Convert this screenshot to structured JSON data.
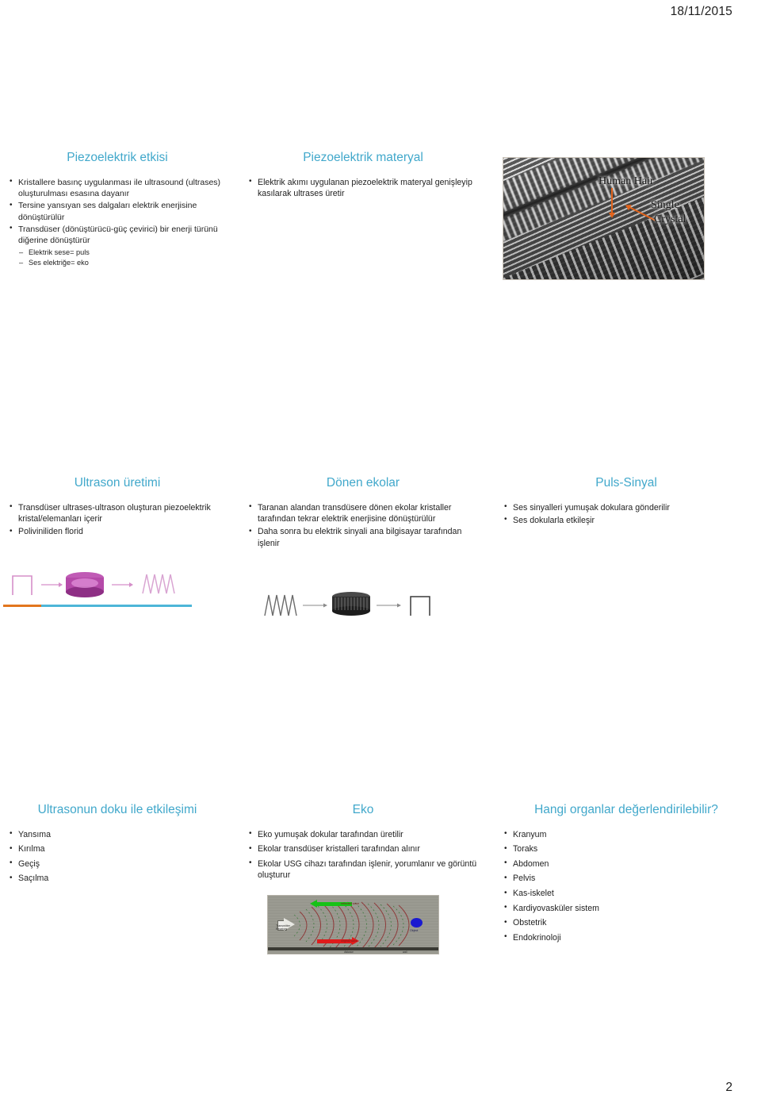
{
  "document": {
    "date": "18/11/2015",
    "page_number": "2"
  },
  "slides": [
    {
      "title": "Piezoelektrik etkisi",
      "bullets": [
        "Kristallere basınç uygulanması ile ultrasound (ultrases) oluşturulması esasına dayanır",
        "Tersine yansıyan ses dalgaları elektrik enerjisine dönüştürülür",
        "Transdüser (dönüştürücü-güç çevirici) bir enerji türünü diğerine dönüştürür"
      ],
      "subbullets": [
        "Elektrik sese= puls",
        "Ses elektriğe= eko"
      ]
    },
    {
      "title": "Piezoelektrik materyal",
      "bullets": [
        "Elektrik akımı uygulanan piezoelektrik materyal genişleyip kasılarak ultrases üretir"
      ]
    },
    {
      "title": "Ultrason üretimi",
      "bullets": [
        "Transdüser ultrases-ultrason oluşturan piezoelektrik kristal/elemanları içerir",
        "Poliviniliden florid"
      ]
    },
    {
      "title": "Dönen ekolar",
      "bullets": [
        "Taranan alandan transdüsere dönen ekolar kristaller tarafından tekrar elektrik enerjisine dönüştürülür",
        "Daha sonra bu elektrik sinyali ana bilgisayar tarafından işlenir"
      ]
    },
    {
      "title": "Puls-Sinyal",
      "bullets": [
        "Ses sinyalleri yumuşak dokulara gönderilir",
        "Ses dokularla etkileşir"
      ]
    },
    {
      "title": "Ultrasonun doku ile etkileşimi",
      "bullets": [
        "Yansıma",
        "Kırılma",
        "Geçiş",
        "Saçılma"
      ]
    },
    {
      "title": "Eko",
      "bullets": [
        "Eko yumuşak dokular tarafından üretilir",
        "Ekolar transdüser kristalleri tarafından alınır",
        "Ekolar USG cihazı tarafından işlenir, yorumlanır ve görüntü oluşturur"
      ]
    },
    {
      "title": "Hangi organlar değerlendirilebilir?",
      "bullets": [
        "Kranyum",
        "Toraks",
        "Abdomen",
        "Pelvis",
        "Kas-iskelet",
        "Kardiyovasküler sistem",
        "Obstetrik",
        "Endokrinoloji"
      ]
    }
  ],
  "figures": {
    "hair_micrograph": {
      "label_hair": "Human Hair",
      "label_single": "Single",
      "label_crystal": "Crystal",
      "arrow_color": "#e2641c"
    },
    "echo_diagram": {
      "label_transmitter": "Transmitter\nReceiver",
      "label_object": "Object",
      "label_reflected": "reflected wave",
      "label_original": "original wave",
      "label_distance": "distance",
      "label_wall": "wall",
      "arrow_reflected_color": "#17c217",
      "arrow_original_color": "#e01b1b",
      "object_color": "#1a1ad0"
    },
    "transducer_forward": {
      "accent_color": "#cf6fc4",
      "bar_orange": "#e2761e",
      "bar_teal": "#4db6d8"
    },
    "transducer_reverse": {
      "accent_color": "#3a3a3a"
    }
  },
  "theme": {
    "title_color": "#41a8cb",
    "text_color": "#1f1f1f"
  }
}
